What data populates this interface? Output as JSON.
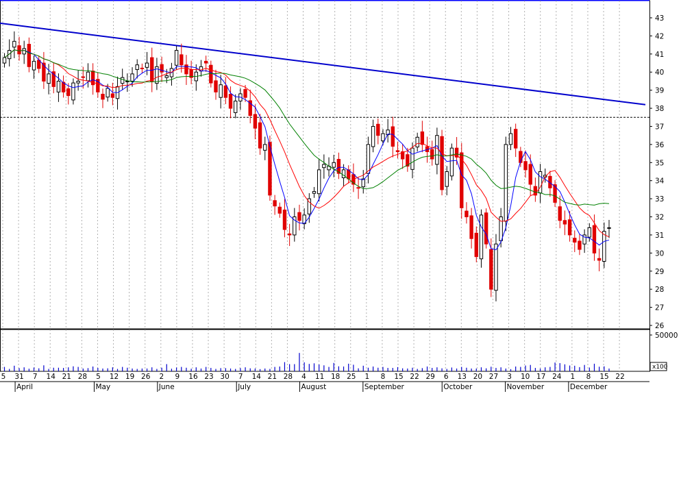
{
  "chart_data": {
    "type": "candlestick",
    "title": "",
    "xlabel": "",
    "ylabel": "",
    "price_ylim": [
      25.6,
      43.3
    ],
    "price_ticks": [
      "43",
      "42",
      "41",
      "40",
      "39",
      "38",
      "37",
      "36",
      "35",
      "34",
      "33",
      "32",
      "31",
      "30",
      "29",
      "28",
      "27",
      "26"
    ],
    "volume_tick_label": "50000",
    "volume_multiplier_label": "x100",
    "resistance_level": 37.5,
    "trendline": {
      "start": 42.7,
      "end": 38.2
    },
    "day_labels": [
      "5",
      "31",
      "7",
      "14",
      "21",
      "28",
      "5",
      "12",
      "19",
      "26",
      "2",
      "9",
      "16",
      "23",
      "30",
      "7",
      "14",
      "21",
      "28",
      "4",
      "11",
      "18",
      "25",
      "1",
      "8",
      "15",
      "22",
      "29",
      "6",
      "13",
      "20",
      "27",
      "3",
      "10",
      "17",
      "24",
      "1",
      "8",
      "15",
      "22"
    ],
    "month_labels": [
      {
        "label": "April",
        "day_index": 1
      },
      {
        "label": "May",
        "day_index": 6
      },
      {
        "label": "June",
        "day_index": 10
      },
      {
        "label": "July",
        "day_index": 15
      },
      {
        "label": "August",
        "day_index": 19
      },
      {
        "label": "September",
        "day_index": 23
      },
      {
        "label": "October",
        "day_index": 28
      },
      {
        "label": "November",
        "day_index": 32
      },
      {
        "label": "December",
        "day_index": 36
      }
    ],
    "series": [
      {
        "name": "",
        "role": "ohlc"
      },
      {
        "name": "",
        "role": "moving-average-short",
        "color": "#0000ff"
      },
      {
        "name": "",
        "role": "moving-average-medium",
        "color": "#ff0000"
      },
      {
        "name": "",
        "role": "moving-average-long",
        "color": "#008000"
      }
    ],
    "closes": [
      40.8,
      41.2,
      41.7,
      41.0,
      41.3,
      40.3,
      40.6,
      40.2,
      39.5,
      39.9,
      39.2,
      39.5,
      38.9,
      38.7,
      39.4,
      39.5,
      39.7,
      40.0,
      39.3,
      38.9,
      38.5,
      39.1,
      38.6,
      39.2,
      39.7,
      39.5,
      39.9,
      40.4,
      40.2,
      40.5,
      39.5,
      40.3,
      40.0,
      39.8,
      40.2,
      41.2,
      40.4,
      39.9,
      39.7,
      40.0,
      40.3,
      40.5,
      39.4,
      38.9,
      39.3,
      38.6,
      38.0,
      38.4,
      38.8,
      38.6,
      37.6,
      36.9,
      35.8,
      36.0,
      33.2,
      32.6,
      32.2,
      31.3,
      31.0,
      32.0,
      31.8,
      32.1,
      33.0,
      33.4,
      34.6,
      34.9,
      34.8,
      35.0,
      34.4,
      34.6,
      34.1,
      33.8,
      33.6,
      34.1,
      36.0,
      37.0,
      36.5,
      36.6,
      36.8,
      35.9,
      35.6,
      35.2,
      34.8,
      35.8,
      36.4,
      36.0,
      35.6,
      35.2,
      36.5,
      33.5,
      34.5,
      35.8,
      35.3,
      32.5,
      32.0,
      30.8,
      29.8,
      32.1,
      30.5,
      28.0,
      30.5,
      32.0,
      36.0,
      36.6,
      35.8,
      35.0,
      34.6,
      33.8,
      33.2,
      34.5,
      34.3,
      33.6,
      32.8,
      31.8,
      31.6,
      31.0,
      30.6,
      30.2,
      31.0,
      31.4,
      30.0,
      29.6,
      31.2,
      31.4
    ],
    "volumes": [
      22,
      12,
      28,
      16,
      20,
      13,
      19,
      15,
      30,
      12,
      18,
      18,
      17,
      20,
      25,
      22,
      14,
      16,
      24,
      17,
      14,
      15,
      20,
      12,
      22,
      18,
      14,
      12,
      14,
      14,
      20,
      12,
      18,
      36,
      13,
      19,
      22,
      18,
      13,
      20,
      14,
      22,
      17,
      12,
      16,
      16,
      14,
      12,
      16,
      20,
      15,
      14,
      11,
      14,
      12,
      22,
      24,
      46,
      36,
      36,
      92,
      45,
      37,
      40,
      34,
      30,
      22,
      42,
      25,
      24,
      38,
      33,
      15,
      28,
      18,
      24,
      18,
      22,
      17,
      17,
      21,
      15,
      14,
      18,
      12,
      16,
      24,
      17,
      20,
      15,
      12,
      19,
      14,
      22,
      18,
      14,
      14,
      20,
      15,
      23,
      17,
      20,
      14,
      11,
      24,
      22,
      29,
      32,
      17,
      14,
      20,
      22,
      44,
      41,
      35,
      29,
      28,
      21,
      32,
      19,
      38,
      23,
      25,
      14
    ]
  }
}
